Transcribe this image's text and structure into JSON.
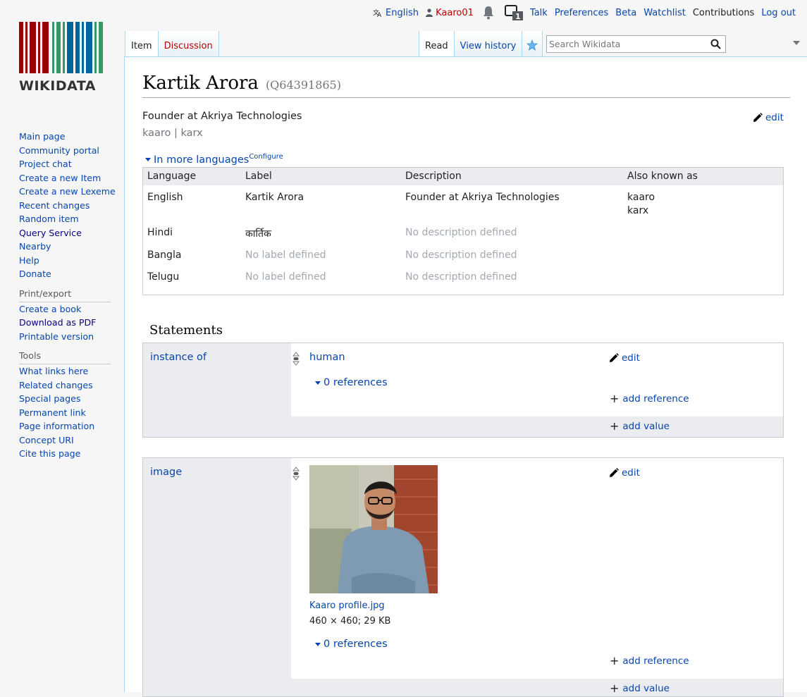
{
  "logo": {
    "text": "WIKIDATA",
    "bar_colors": [
      "#990000",
      "#339966",
      "#006699"
    ]
  },
  "personal": {
    "language": "English",
    "user": "Kaaro01",
    "notification_count": "1",
    "talk": "Talk",
    "preferences": "Preferences",
    "beta": "Beta",
    "watchlist": "Watchlist",
    "contributions": "Contributions",
    "logout": "Log out"
  },
  "sidebar": {
    "navigation": [
      "Main page",
      "Community portal",
      "Project chat",
      "Create a new Item",
      "Create a new Lexeme",
      "Recent changes",
      "Random item",
      "Query Service",
      "Nearby",
      "Help",
      "Donate"
    ],
    "print_title": "Print/export",
    "print_items": [
      "Create a book",
      "Download as PDF",
      "Printable version"
    ],
    "tools_title": "Tools",
    "tools_items": [
      "What links here",
      "Related changes",
      "Special pages",
      "Permanent link",
      "Page information",
      "Concept URI",
      "Cite this page"
    ]
  },
  "tabs": {
    "item": "Item",
    "discussion": "Discussion",
    "read": "Read",
    "view_history": "View history",
    "search_placeholder": "Search Wikidata"
  },
  "entity": {
    "label": "Kartik Arora",
    "qid": "(Q64391865)",
    "description": "Founder at Akriya Technologies",
    "aliases": "kaaro | karx",
    "edit": "edit"
  },
  "languages": {
    "toggle": "In more languages",
    "configure": "Configure",
    "headers": {
      "language": "Language",
      "label": "Label",
      "description": "Description",
      "aliases": "Also known as"
    },
    "rows": [
      {
        "language": "English",
        "label": "Kartik Arora",
        "description": "Founder at Akriya Technologies",
        "aliases": [
          "kaaro",
          "karx"
        ]
      },
      {
        "language": "Hindi",
        "label": "कार्तिक",
        "description": "No description defined",
        "aliases": []
      },
      {
        "language": "Bangla",
        "label": "No label defined",
        "description": "No description defined",
        "aliases": []
      },
      {
        "language": "Telugu",
        "label": "No label defined",
        "description": "No description defined",
        "aliases": []
      }
    ]
  },
  "statements": {
    "heading": "Statements",
    "instance_of": {
      "property": "instance of",
      "value": "human",
      "references": "0 references",
      "add_reference": "add reference",
      "add_value": "add value",
      "edit": "edit"
    },
    "image": {
      "property": "image",
      "file": "Kaaro profile.jpg",
      "meta": "460 × 460; 29 KB",
      "references": "0 references",
      "add_reference": "add reference",
      "add_value": "add value",
      "edit": "edit"
    }
  }
}
